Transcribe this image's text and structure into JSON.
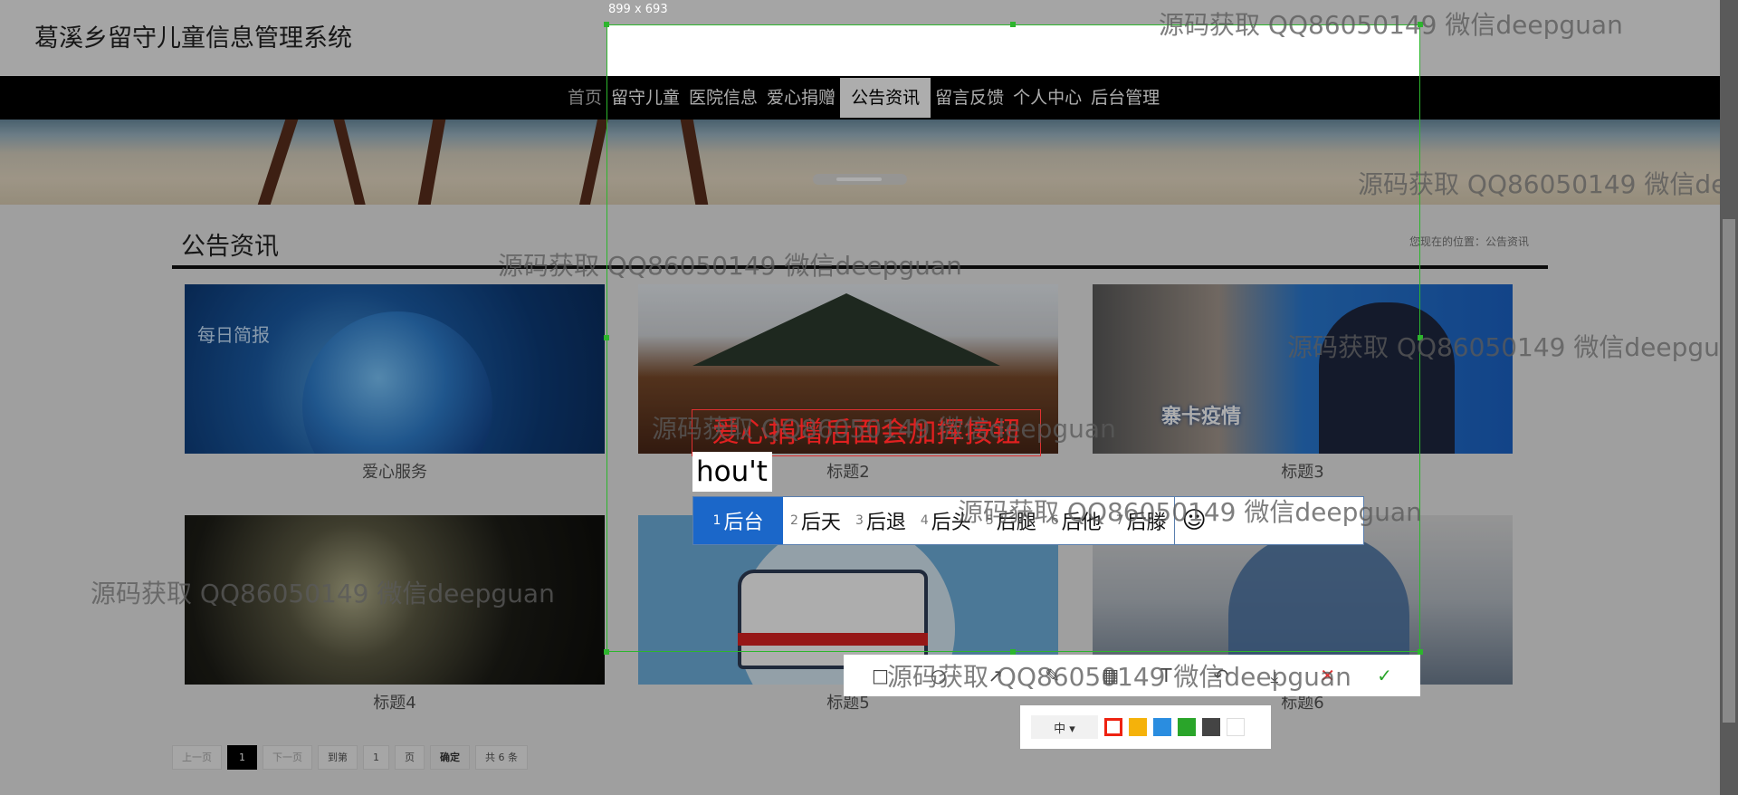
{
  "header": {
    "site_title": "葛溪乡留守儿童信息管理系统"
  },
  "nav": {
    "items": [
      "首页",
      "留守儿童",
      "医院信息",
      "爱心捐赠",
      "公告资讯",
      "留言反馈",
      "个人中心",
      "后台管理"
    ],
    "active": "公告资讯"
  },
  "section": {
    "title": "公告资讯",
    "location": "您现在的位置：公告资讯"
  },
  "cards": [
    {
      "caption": "爱心服务",
      "image_text": "每日简报"
    },
    {
      "caption": "标题2"
    },
    {
      "caption": "标题3",
      "image_text": "寨卡疫情"
    },
    {
      "caption": "标题4"
    },
    {
      "caption": "标题5"
    },
    {
      "caption": "标题6"
    }
  ],
  "pagination": {
    "prev": "上一页",
    "current": "1",
    "next": "下一页",
    "goto_label": "到第",
    "goto_value": "1",
    "page_unit": "页",
    "confirm": "确定",
    "total": "共 6 条"
  },
  "screenshot_tool": {
    "size_label": "899 x 693",
    "tools": [
      "rect-tool-icon",
      "ellipse-tool-icon",
      "arrow-tool-icon",
      "pen-tool-icon",
      "mosaic-tool-icon",
      "text-tool-icon",
      "undo-icon",
      "save-icon",
      "cancel-icon",
      "confirm-icon"
    ],
    "tool_glyphs": [
      "□",
      "○",
      "↗",
      "✎",
      "▦",
      "T",
      "↶",
      "⤓",
      "✕",
      "✓"
    ],
    "font_size": "中 ▾",
    "colors": [
      "#e02020",
      "#f5b20a",
      "#2a8de0",
      "#2aa52a",
      "#444444",
      "#ffffff"
    ],
    "annotation_text": "爱心捐增后面会加挥按钮"
  },
  "ime": {
    "input_text": "hou't",
    "candidates": [
      {
        "num": "1",
        "text": "后台"
      },
      {
        "num": "2",
        "text": "后天"
      },
      {
        "num": "3",
        "text": "后退"
      },
      {
        "num": "4",
        "text": "后头"
      },
      {
        "num": "5",
        "text": "后腿"
      },
      {
        "num": "6",
        "text": "后他"
      },
      {
        "num": "7",
        "text": "后滕"
      }
    ],
    "emoji": "☺"
  },
  "watermark": {
    "text": "源码获取 QQ86050149 微信deepguan"
  }
}
